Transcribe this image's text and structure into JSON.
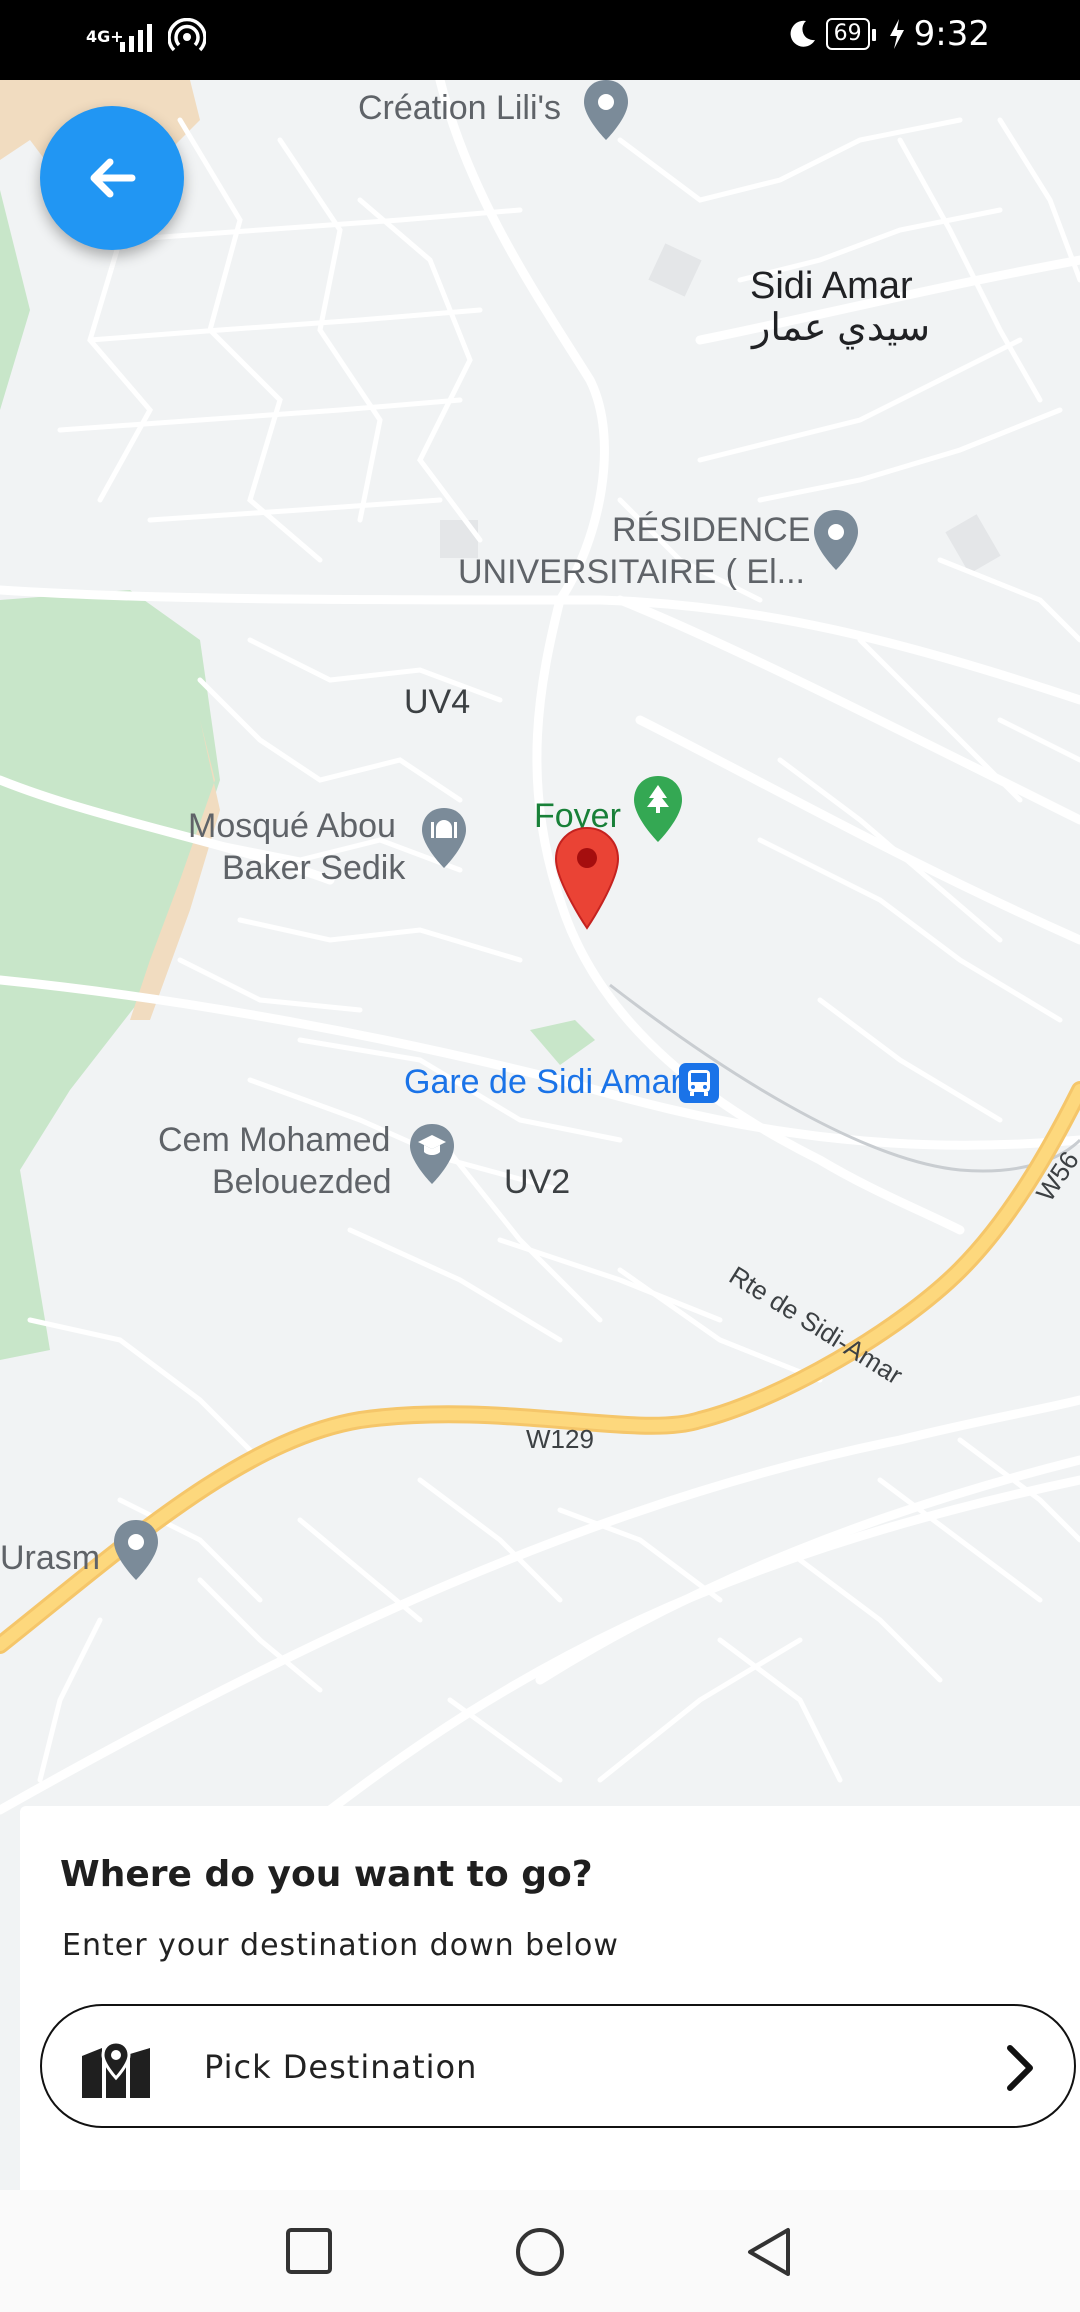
{
  "status_bar": {
    "network_label": "4G+",
    "battery": "69",
    "time": "9:32",
    "icons": [
      "signal-icon",
      "hotspot-icon",
      "moon-icon",
      "battery-icon",
      "charging-icon"
    ]
  },
  "map": {
    "labels": {
      "creation_lilis": "Création Lili's",
      "sidi_amar": "Sidi Amar",
      "sidi_amar_ar": "سيدي عمار",
      "residence_line1": "RÉSIDENCE",
      "residence_line2": "UNIVERSITAIRE ( El...",
      "uv4": "UV4",
      "mosque_line1": "Mosqué Abou",
      "mosque_line2": "Baker Sedik",
      "foyer": "Foyer",
      "gare": "Gare de Sidi Amar",
      "cem_line1": "Cem Mohamed",
      "cem_line2": "Belouezded",
      "uv2": "UV2",
      "rte": "Rte de Sidi-Amar",
      "w56": "W56",
      "w129": "W129",
      "urasm": "Urasm"
    },
    "colors": {
      "background": "#f1f3f4",
      "road": "#ffffff",
      "highway": "#fdd87d",
      "park": "#c8e6c9",
      "selected_pin": "#ea4335",
      "poi_pin": "#7b8b99",
      "transit": "#1a73e8"
    }
  },
  "back_button": {
    "icon": "arrow-left-icon",
    "color": "#2196f3"
  },
  "sheet": {
    "title": "Where do you want to go?",
    "subtitle": "Enter your destination down below",
    "pick_label": "Pick Destination",
    "pick_icon": "map-pin-icon",
    "chevron_icon": "chevron-right-icon"
  },
  "nav_bar": {
    "icons": [
      "recents-square-icon",
      "home-circle-icon",
      "back-triangle-icon"
    ]
  }
}
